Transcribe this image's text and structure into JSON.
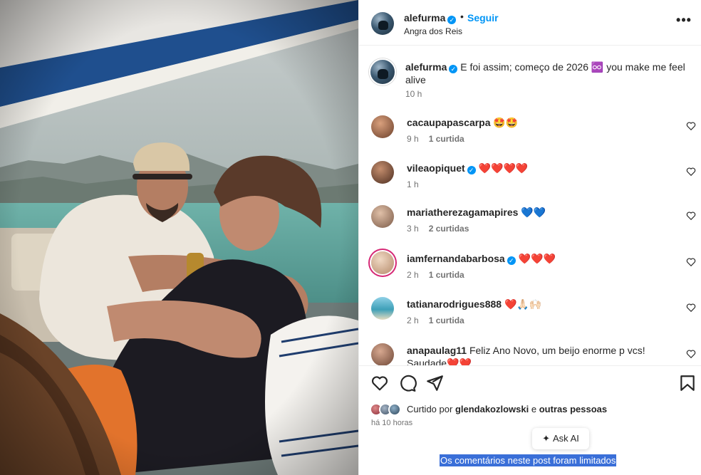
{
  "post": {
    "username": "alefurma",
    "follow_label": "Seguir",
    "separator": "•",
    "location": "Angra dos Reis",
    "more_label": "•••",
    "caption": {
      "username": "alefurma",
      "text": "E foi assim; começo de 2026 ♾️ you make me feel alive",
      "time": "10 h"
    }
  },
  "comments": [
    {
      "username": "cacaupapascarpa",
      "verified": false,
      "text": "🤩🤩",
      "time": "9 h",
      "likes": "1 curtida"
    },
    {
      "username": "vileaopiquet",
      "verified": true,
      "text": "❤️❤️❤️❤️",
      "time": "1 h",
      "likes": ""
    },
    {
      "username": "mariatherezagamapires",
      "verified": false,
      "text": "💙💙",
      "time": "3 h",
      "likes": "2 curtidas"
    },
    {
      "username": "iamfernandabarbosa",
      "verified": true,
      "text": "❤️❤️❤️",
      "time": "2 h",
      "likes": "1 curtida"
    },
    {
      "username": "tatianarodrigues888",
      "verified": false,
      "text": "❤️🙏🏻🙌🏻",
      "time": "2 h",
      "likes": "1 curtida"
    },
    {
      "username": "anapaulag11",
      "verified": false,
      "text": "Feliz Ano Novo, um beijo enorme p vcs! Saudade❤️❤️",
      "time": "",
      "likes": ""
    }
  ],
  "actions": {
    "liked_by_prefix": "Curtido por",
    "liked_by_user": "glendakozlowski",
    "liked_by_conj": "e",
    "liked_by_others": "outras pessoas",
    "post_time": "há 10 horas",
    "ask_ai_label": "Ask AI",
    "limited_notice": "Os comentários neste post foram limitados"
  },
  "icons": {
    "verified": "verified-badge-icon",
    "comment_like": "heart-outline-icon",
    "like": "heart-outline-icon",
    "comment": "comment-bubble-icon",
    "share": "paper-plane-icon",
    "save": "bookmark-icon",
    "ask_ai": "sparkle-icon",
    "more": "more-options-icon"
  },
  "colors": {
    "accent": "#0095f6",
    "text": "#262626",
    "muted": "#737373",
    "selection": "#3a6fd8"
  }
}
